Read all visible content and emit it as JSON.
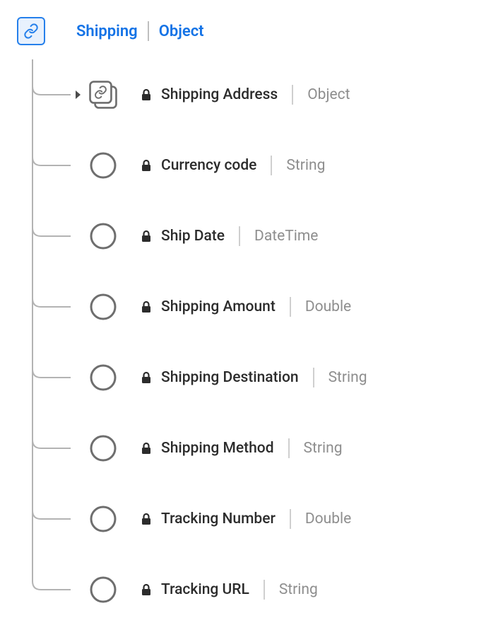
{
  "root": {
    "name": "Shipping",
    "type": "Object"
  },
  "fields": [
    {
      "name": "Shipping Address",
      "type": "Object",
      "expandable": true,
      "icon": "stack"
    },
    {
      "name": "Currency code",
      "type": "String",
      "expandable": false,
      "icon": "circle"
    },
    {
      "name": "Ship Date",
      "type": "DateTime",
      "expandable": false,
      "icon": "circle"
    },
    {
      "name": "Shipping Amount",
      "type": "Double",
      "expandable": false,
      "icon": "circle"
    },
    {
      "name": "Shipping Destination",
      "type": "String",
      "expandable": false,
      "icon": "circle"
    },
    {
      "name": "Shipping Method",
      "type": "String",
      "expandable": false,
      "icon": "circle"
    },
    {
      "name": "Tracking Number",
      "type": "Double",
      "expandable": false,
      "icon": "circle"
    },
    {
      "name": "Tracking URL",
      "type": "String",
      "expandable": false,
      "icon": "circle"
    }
  ]
}
